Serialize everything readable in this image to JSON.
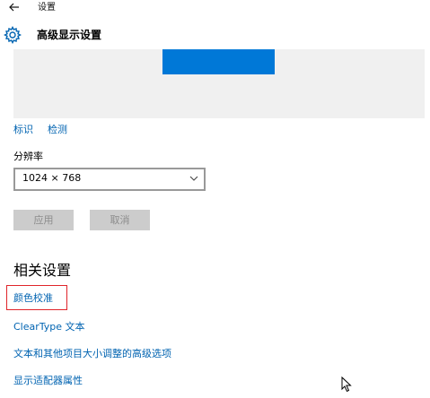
{
  "window": {
    "title": "设置"
  },
  "header": {
    "title": "高级显示设置",
    "icon": "gear-icon"
  },
  "display_links": {
    "identify": "标识",
    "detect": "检测"
  },
  "resolution": {
    "label": "分辨率",
    "value": "1024 × 768"
  },
  "buttons": {
    "apply": "应用",
    "cancel": "取消"
  },
  "related": {
    "title": "相关设置",
    "links": {
      "color_calibration": "颜色校准",
      "cleartype": "ClearType 文本",
      "advanced_sizing": "文本和其他项目大小调整的高级选项",
      "adapter_properties": "显示适配器属性"
    }
  },
  "colors": {
    "accent": "#0078d7",
    "link": "#0063b1",
    "highlight": "#e0242a",
    "button_disabled": "#cccccc"
  }
}
